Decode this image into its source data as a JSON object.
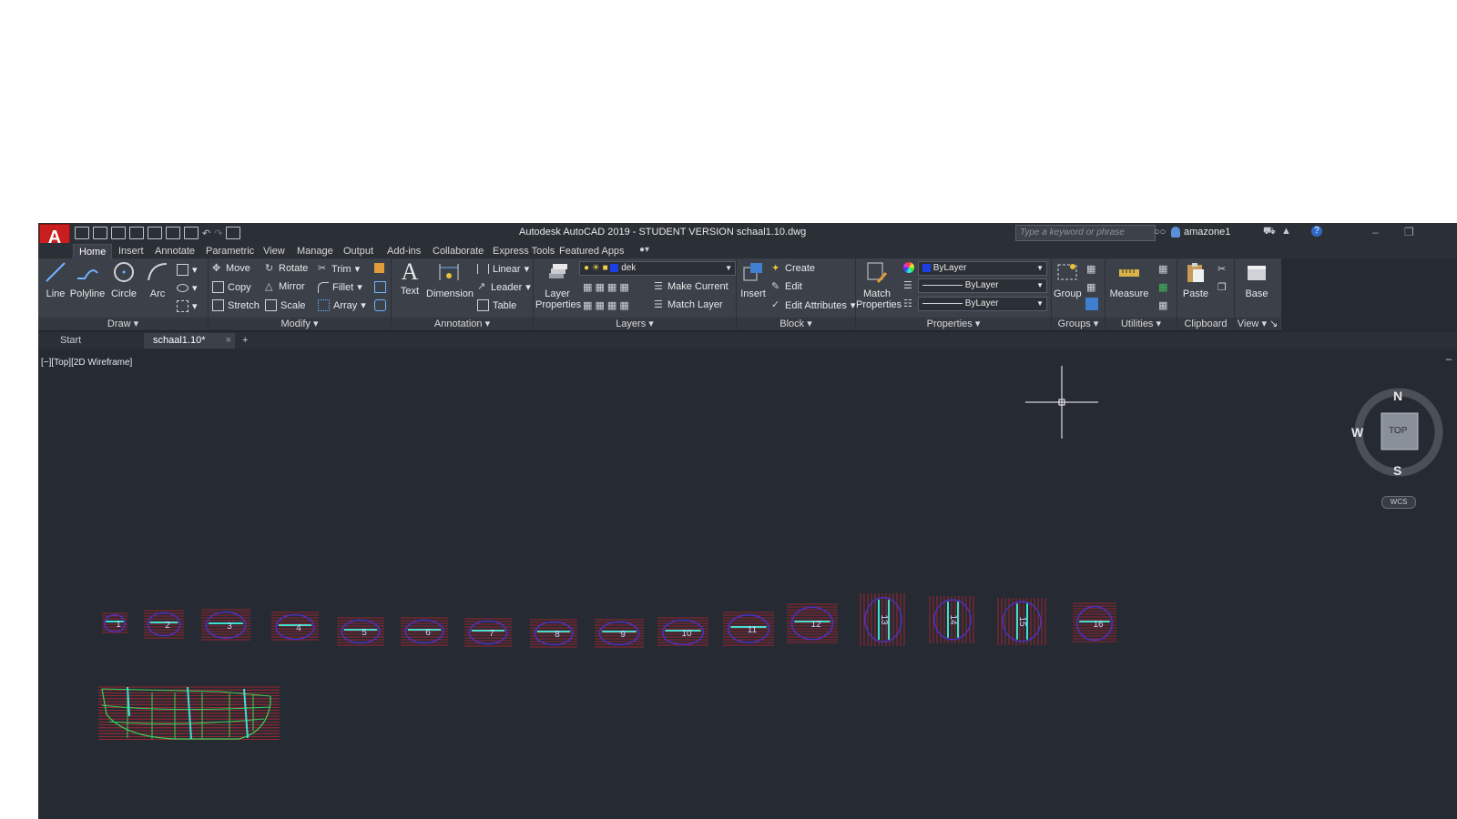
{
  "app": {
    "title": "Autodesk AutoCAD 2019 - STUDENT VERSION    schaal1.10.dwg",
    "logo": "A",
    "search_placeholder": "Type a keyword or phrase",
    "user": "amazone1"
  },
  "ribbon_tabs": [
    "Home",
    "Insert",
    "Annotate",
    "Parametric",
    "View",
    "Manage",
    "Output",
    "Add-ins",
    "Collaborate",
    "Express Tools",
    "Featured Apps"
  ],
  "ribbon": {
    "draw": {
      "title": "Draw",
      "line": "Line",
      "polyline": "Polyline",
      "circle": "Circle",
      "arc": "Arc"
    },
    "modify": {
      "title": "Modify",
      "move": "Move",
      "rotate": "Rotate",
      "trim": "Trim",
      "copy": "Copy",
      "mirror": "Mirror",
      "fillet": "Fillet",
      "stretch": "Stretch",
      "scale": "Scale",
      "array": "Array"
    },
    "annotation": {
      "title": "Annotation",
      "text": "Text",
      "dimension": "Dimension",
      "linear": "Linear",
      "leader": "Leader",
      "table": "Table"
    },
    "layers": {
      "title": "Layers",
      "layer_properties_1": "Layer",
      "layer_properties_2": "Properties",
      "current_layer": "dek",
      "make_current": "Make Current",
      "match_layer": "Match Layer"
    },
    "block": {
      "title": "Block",
      "insert": "Insert",
      "create": "Create",
      "edit": "Edit",
      "edit_attributes": "Edit Attributes"
    },
    "properties": {
      "title": "Properties",
      "match_1": "Match",
      "match_2": "Properties",
      "color": "ByLayer",
      "linetype": "ByLayer",
      "lineweight": "ByLayer"
    },
    "groups": {
      "title": "Groups",
      "group": "Group"
    },
    "utilities": {
      "title": "Utilities",
      "measure": "Measure"
    },
    "clipboard": {
      "title": "Clipboard",
      "paste": "Paste"
    },
    "view": {
      "title": "View",
      "base": "Base"
    }
  },
  "doc_tabs": [
    "Start",
    "schaal1.10*"
  ],
  "viewport": {
    "label": "[−][Top][2D Wireframe]",
    "viewcube": {
      "n": "N",
      "s": "S",
      "w": "W",
      "top": "TOP",
      "wcs": "WCS"
    }
  },
  "drawing": {
    "sections": [
      "1",
      "2",
      "3",
      "4",
      "5",
      "6",
      "7",
      "8",
      "9",
      "10",
      "11",
      "12",
      "13",
      "14",
      "15",
      "16"
    ]
  }
}
